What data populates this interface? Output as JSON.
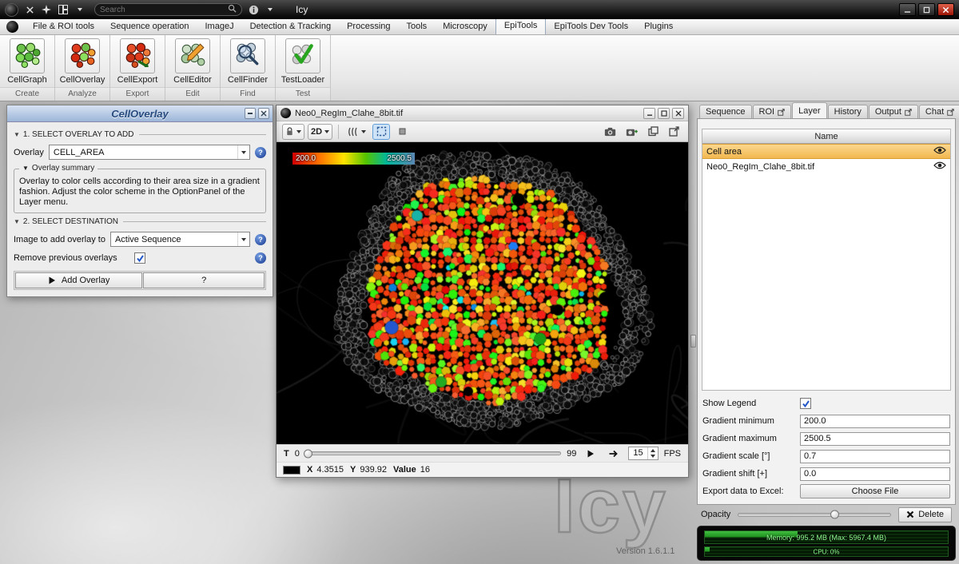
{
  "titlebar": {
    "title": "Icy",
    "search_placeholder": "Search"
  },
  "menu_tabs": [
    "File & ROI tools",
    "Sequence operation",
    "ImageJ",
    "Detection & Tracking",
    "Processing",
    "Tools",
    "Microscopy",
    "EpiTools",
    "EpiTools Dev Tools",
    "Plugins"
  ],
  "active_menu_tab": "EpiTools",
  "ribbon_groups": [
    {
      "item": "CellGraph",
      "label": "Create"
    },
    {
      "item": "CellOverlay",
      "label": "Analyze"
    },
    {
      "item": "CellExport",
      "label": "Export"
    },
    {
      "item": "CellEditor",
      "label": "Edit"
    },
    {
      "item": "CellFinder",
      "label": "Find"
    },
    {
      "item": "TestLoader",
      "label": "Test"
    }
  ],
  "dialog": {
    "title": "CellOverlay",
    "collapse_glyph": "▼",
    "section1_title": "1. SELECT OVERLAY TO ADD",
    "overlay_label": "Overlay",
    "overlay_value": "CELL_AREA",
    "summary_title": "Overlay summary",
    "summary_text": "Overlay to color cells according to their area size in a gradient fashion. Adjust the color scheme in the OptionPanel of the Layer menu.",
    "section2_title": "2. SELECT DESTINATION",
    "destination_label": "Image to add overlay to",
    "destination_value": "Active Sequence",
    "remove_overlays_label": "Remove previous overlays",
    "add_overlay_button": "Add Overlay",
    "help_glyph": "?"
  },
  "image_window": {
    "title": "Neo0_RegIm_Clahe_8bit.tif",
    "view_mode": "2D",
    "legend_min": "200.0",
    "legend_max": "2500.5",
    "t_label": "T",
    "t_value": "0",
    "t_max": "99",
    "fps_value": "15",
    "fps_label": "FPS",
    "x_label": "X",
    "x_value": "4.3515",
    "y_label": "Y",
    "y_value": "939.92",
    "value_label": "Value",
    "pixel_value": "16"
  },
  "right_panel": {
    "tabs": [
      "Sequence",
      "ROI",
      "Layer",
      "History",
      "Output",
      "Chat"
    ],
    "active_tab": "Layer",
    "table_header": "Name",
    "layers": [
      "Cell area",
      "Neo0_RegIm_Clahe_8bit.tif"
    ],
    "show_legend_label": "Show Legend",
    "gradient_minimum_label": "Gradient minimum",
    "gradient_minimum_value": "200.0",
    "gradient_maximum_label": "Gradient maximum",
    "gradient_maximum_value": "2500.5",
    "gradient_scale_label": "Gradient scale [°]",
    "gradient_scale_value": "0.7",
    "gradient_shift_label": "Gradient shift [+]",
    "gradient_shift_value": "0.0",
    "export_label": "Export data to Excel:",
    "choose_file_button": "Choose File",
    "opacity_label": "Opacity",
    "delete_button": "Delete"
  },
  "monitor": {
    "memory_text": "Memory: 995.2 MB  (Max: 5967.4 MB)",
    "cpu_text": "CPU: 0%"
  },
  "watermark": {
    "logo_text": "Icy",
    "version_text": "Version 1.6.1.1"
  },
  "colors": {
    "selection_orange": "#f2b750",
    "accent_blue": "#3a6bc6",
    "memory_green": "#66ef66"
  }
}
